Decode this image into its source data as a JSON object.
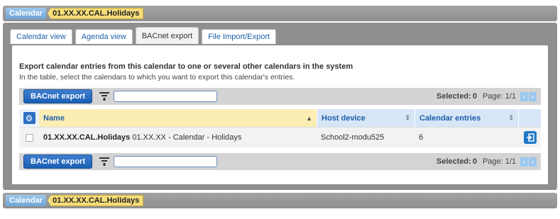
{
  "breadcrumb": {
    "root": "Calendar",
    "current": "01.XX.XX.CAL.Holidays"
  },
  "tabs": [
    {
      "label": "Calendar view",
      "active": false
    },
    {
      "label": "Agenda view",
      "active": false
    },
    {
      "label": "BACnet export",
      "active": true
    },
    {
      "label": "File Import/Export",
      "active": false
    }
  ],
  "content": {
    "heading": "Export calendar entries from this calendar to one or several other calendars in the system",
    "subheading": "In the table, select the calendars to which you want to export this calendar's entries."
  },
  "toolbar": {
    "export_label": "BACnet export",
    "filter_value": "",
    "selected_label": "Selected:",
    "selected_count": "0",
    "page_label": "Page:",
    "page_value": "1/1"
  },
  "grid": {
    "columns": [
      {
        "label": "Name"
      },
      {
        "label": "Host device"
      },
      {
        "label": "Calendar entries"
      }
    ],
    "rows": [
      {
        "name_bold": "01.XX.XX.CAL.Holidays",
        "name_rest": " 01.XX.XX - Calendar - Holidays",
        "host": "School2-modu525",
        "entries": "6"
      }
    ]
  },
  "colors": {
    "accent": "#1a5fb4",
    "breadcrumb_current": "#f6dd7a",
    "sorted_column": "#fcedb4"
  }
}
